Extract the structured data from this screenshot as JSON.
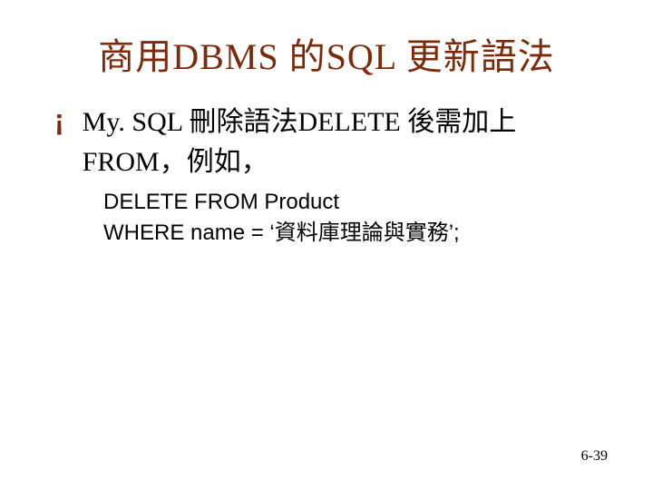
{
  "title": "商用DBMS 的SQL 更新語法",
  "bullet_marker": "¡",
  "body_line": "My. SQL 刪除語法DELETE 後需加上FROM，例如，",
  "code_line_1": "DELETE FROM Product",
  "code_line_2": "WHERE name = ‘資料庫理論與實務’;",
  "page_number": "6-39"
}
